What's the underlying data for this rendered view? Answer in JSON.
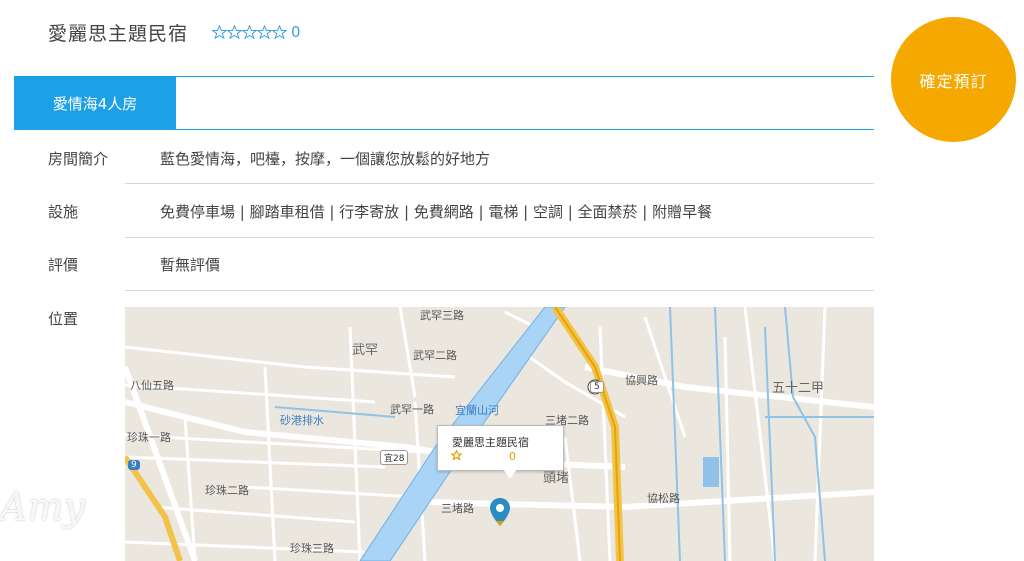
{
  "header": {
    "hotel_name": "愛麗思主題民宿",
    "star_icon": "star-outline-icon",
    "stars_total": 5,
    "stars_filled": 0,
    "rating_count": "0"
  },
  "book_button": {
    "label": "確定預訂",
    "color": "#f5a800"
  },
  "tabs": [
    {
      "label": "愛情海4人房",
      "active": true
    }
  ],
  "accent_color": "#1ea0e6",
  "details": {
    "intro_label": "房間簡介",
    "intro_value": "藍色愛情海，吧檯，按摩，一個讓您放鬆的好地方",
    "facilities_label": "設施",
    "facilities_value": "免費停車場 | 腳踏車租借 | 行李寄放 | 免費網路 | 電梯 | 空調 | 全面禁菸 | 附贈早餐",
    "reviews_label": "評價",
    "reviews_value": "暫無評價",
    "location_label": "位置"
  },
  "map": {
    "popup_name": "愛麗思主題民宿",
    "popup_count": "0",
    "marker_icon": "map-pin-icon",
    "labels": {
      "wuhan": "武罕",
      "toucheng": "頭堵",
      "wushier": "五十二甲",
      "bashan": "八仙五路",
      "shagang": "砂港排水",
      "zhenzhu1": "珍珠一路",
      "zhenzhu2": "珍珠二路",
      "zhenzhu3": "珍珠三路",
      "wuhan1": "武罕一路",
      "wuhan2": "武罕二路",
      "wuhan3": "武罕三路",
      "sancheng": "三堵路",
      "sancheng2": "三堵二路",
      "xiesong": "協松路",
      "xiexing": "協興路",
      "river": "宜蘭山河",
      "route5": "5",
      "route9": "9",
      "route28": "宜28"
    }
  },
  "watermark": "Amy"
}
